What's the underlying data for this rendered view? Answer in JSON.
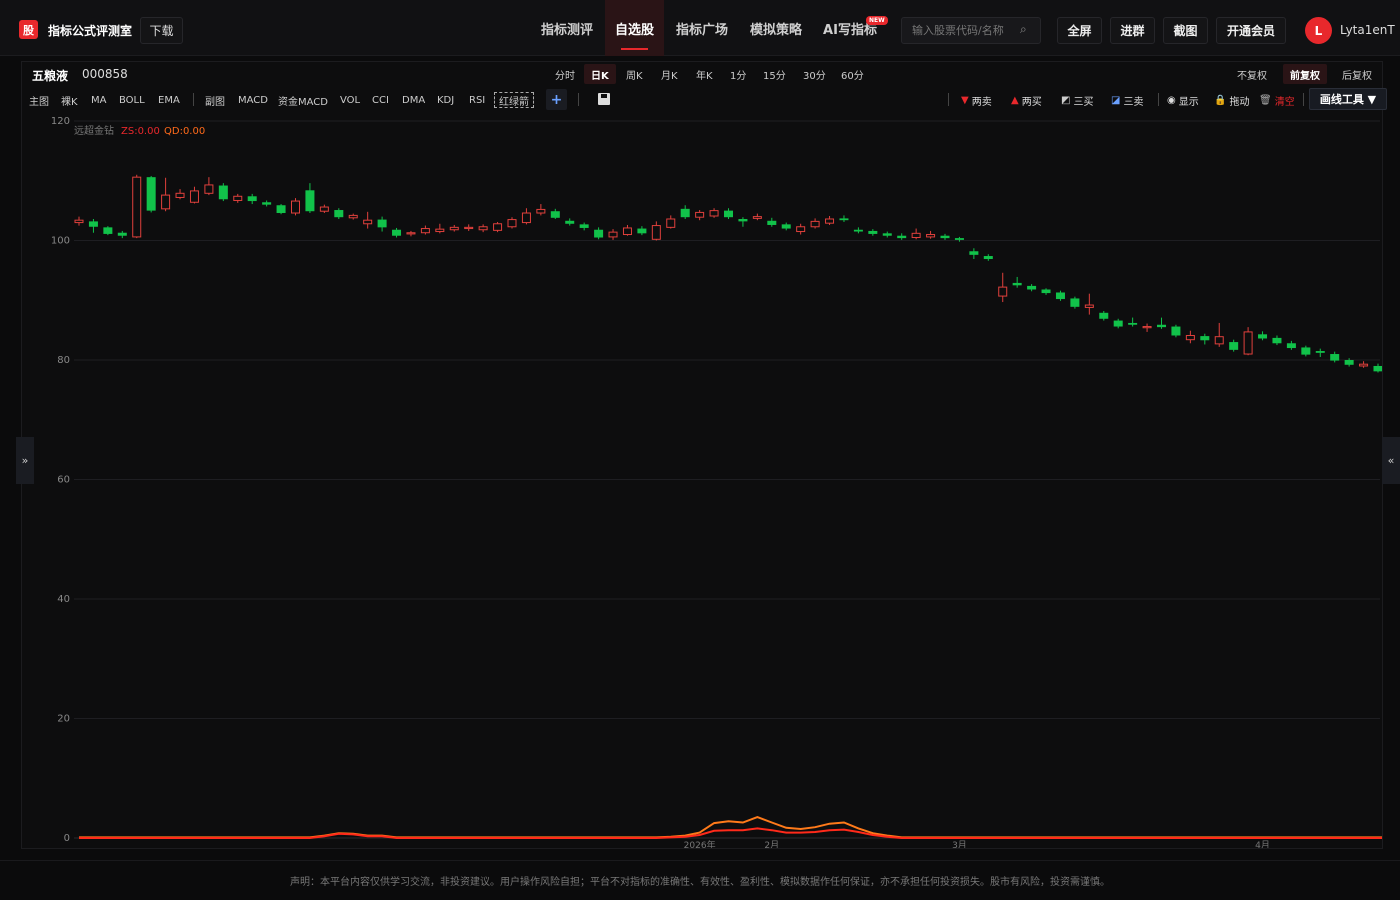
{
  "header": {
    "logo_char": "股",
    "app_name": "指标公式评测室",
    "download_label": "下载",
    "nav": [
      {
        "label": "指标测评",
        "active": false
      },
      {
        "label": "自选股",
        "active": true
      },
      {
        "label": "指标广场",
        "active": false
      },
      {
        "label": "模拟策略",
        "active": false
      },
      {
        "label": "AI写指标",
        "active": false,
        "badge": "NEW"
      }
    ],
    "search_placeholder": "输入股票代码/名称",
    "buttons": [
      "全屏",
      "进群",
      "截图",
      "开通会员"
    ],
    "avatar_letter": "L",
    "username": "Lyta1enT"
  },
  "stock": {
    "name": "五粮液",
    "code": "000858"
  },
  "periods": [
    {
      "label": "分时",
      "active": false
    },
    {
      "label": "日K",
      "active": true
    },
    {
      "label": "周K",
      "active": false
    },
    {
      "label": "月K",
      "active": false
    },
    {
      "label": "年K",
      "active": false
    },
    {
      "label": "1分",
      "active": false
    },
    {
      "label": "15分",
      "active": false
    },
    {
      "label": "30分",
      "active": false
    },
    {
      "label": "60分",
      "active": false
    }
  ],
  "adjust": [
    {
      "label": "不复权",
      "active": false
    },
    {
      "label": "前复权",
      "active": true
    },
    {
      "label": "后复权",
      "active": false
    }
  ],
  "indicators": {
    "main_group": [
      "主图",
      "裸K",
      "MA",
      "BOLL",
      "EMA"
    ],
    "sub_group": [
      "副图",
      "MACD",
      "资金MACD",
      "VOL",
      "CCI",
      "DMA",
      "KDJ",
      "RSI",
      "红绿箭"
    ],
    "add_label": "+"
  },
  "tools": {
    "two_sell": "两卖",
    "two_buy": "两买",
    "three_buy": "三买",
    "three_sell": "三卖",
    "show": "显示",
    "drag": "拖动",
    "clear": "清空",
    "draw_tools": "画线工具 ▼"
  },
  "legend": {
    "name": "远超金钻",
    "zs": "ZS:0.00",
    "qd": "QD:0.00"
  },
  "side_tabs": {
    "left": "»",
    "right": "«"
  },
  "footer": "声明：本平台内容仅供学习交流，非投资建议。用户操作风险自担；平台不对指标的准确性、有效性、盈利性、模拟数据作任何保证，亦不承担任何投资损失。股市有风险，投资需谨慎。",
  "colors": {
    "up": "#e0403c",
    "down": "#11c24a",
    "accent": "#e8282c",
    "line_orange": "#ff7a1a",
    "line_red": "#ff2a1a"
  },
  "chart_data": {
    "type": "candlestick",
    "ylim": [
      0,
      120
    ],
    "y_ticks": [
      0,
      20,
      40,
      60,
      80,
      100,
      120
    ],
    "x_labels": [
      "2026年",
      "2月",
      "3月",
      "4月"
    ],
    "x_label_positions": [
      43,
      48,
      61,
      82
    ],
    "candles": [
      {
        "o": 103.0,
        "c": 103.4,
        "h": 104.0,
        "l": 102.5
      },
      {
        "o": 103.2,
        "c": 102.3,
        "h": 103.6,
        "l": 101.3
      },
      {
        "o": 102.2,
        "c": 101.1,
        "h": 102.4,
        "l": 100.9
      },
      {
        "o": 101.3,
        "c": 100.8,
        "h": 101.6,
        "l": 100.4
      },
      {
        "o": 100.6,
        "c": 110.6,
        "h": 111.0,
        "l": 100.4
      },
      {
        "o": 110.6,
        "c": 105.0,
        "h": 110.8,
        "l": 104.7
      },
      {
        "o": 105.3,
        "c": 107.6,
        "h": 110.5,
        "l": 104.9
      },
      {
        "o": 107.2,
        "c": 107.9,
        "h": 108.6,
        "l": 106.9
      },
      {
        "o": 106.4,
        "c": 108.3,
        "h": 109.0,
        "l": 106.2
      },
      {
        "o": 107.9,
        "c": 109.3,
        "h": 110.6,
        "l": 107.6
      },
      {
        "o": 109.2,
        "c": 106.9,
        "h": 109.6,
        "l": 106.6
      },
      {
        "o": 106.7,
        "c": 107.4,
        "h": 107.8,
        "l": 106.3
      },
      {
        "o": 107.4,
        "c": 106.6,
        "h": 107.8,
        "l": 106.1
      },
      {
        "o": 106.4,
        "c": 106.0,
        "h": 106.7,
        "l": 105.7
      },
      {
        "o": 105.9,
        "c": 104.6,
        "h": 106.1,
        "l": 104.4
      },
      {
        "o": 104.6,
        "c": 106.6,
        "h": 107.1,
        "l": 104.2
      },
      {
        "o": 108.4,
        "c": 104.9,
        "h": 109.6,
        "l": 104.6
      },
      {
        "o": 104.9,
        "c": 105.6,
        "h": 106.0,
        "l": 104.6
      },
      {
        "o": 105.1,
        "c": 103.9,
        "h": 105.4,
        "l": 103.6
      },
      {
        "o": 103.8,
        "c": 104.2,
        "h": 104.5,
        "l": 103.5
      },
      {
        "o": 102.8,
        "c": 103.4,
        "h": 104.8,
        "l": 102.0
      },
      {
        "o": 103.5,
        "c": 102.2,
        "h": 104.0,
        "l": 101.5
      },
      {
        "o": 101.8,
        "c": 100.8,
        "h": 102.1,
        "l": 100.5
      },
      {
        "o": 101.1,
        "c": 101.3,
        "h": 101.6,
        "l": 100.7
      },
      {
        "o": 101.3,
        "c": 102.0,
        "h": 102.5,
        "l": 101.0
      },
      {
        "o": 101.5,
        "c": 101.9,
        "h": 102.8,
        "l": 101.2
      },
      {
        "o": 101.8,
        "c": 102.2,
        "h": 102.6,
        "l": 101.5
      },
      {
        "o": 102.0,
        "c": 102.2,
        "h": 102.7,
        "l": 101.6
      },
      {
        "o": 101.8,
        "c": 102.3,
        "h": 102.7,
        "l": 101.4
      },
      {
        "o": 101.7,
        "c": 102.8,
        "h": 103.1,
        "l": 101.4
      },
      {
        "o": 102.3,
        "c": 103.5,
        "h": 103.9,
        "l": 102.0
      },
      {
        "o": 103.0,
        "c": 104.6,
        "h": 105.4,
        "l": 102.7
      },
      {
        "o": 104.6,
        "c": 105.2,
        "h": 106.1,
        "l": 104.2
      },
      {
        "o": 104.9,
        "c": 103.8,
        "h": 105.3,
        "l": 103.6
      },
      {
        "o": 103.3,
        "c": 102.8,
        "h": 103.7,
        "l": 102.5
      },
      {
        "o": 102.7,
        "c": 102.1,
        "h": 103.0,
        "l": 101.7
      },
      {
        "o": 101.8,
        "c": 100.5,
        "h": 102.2,
        "l": 100.2
      },
      {
        "o": 100.6,
        "c": 101.4,
        "h": 101.9,
        "l": 100.1
      },
      {
        "o": 101.0,
        "c": 102.1,
        "h": 102.6,
        "l": 100.8
      },
      {
        "o": 102.0,
        "c": 101.2,
        "h": 102.4,
        "l": 100.9
      },
      {
        "o": 100.2,
        "c": 102.5,
        "h": 103.2,
        "l": 100.0
      },
      {
        "o": 102.2,
        "c": 103.6,
        "h": 104.2,
        "l": 102.0
      },
      {
        "o": 105.3,
        "c": 103.9,
        "h": 105.9,
        "l": 103.6
      },
      {
        "o": 103.9,
        "c": 104.7,
        "h": 105.1,
        "l": 103.4
      },
      {
        "o": 104.1,
        "c": 105.0,
        "h": 105.4,
        "l": 103.8
      },
      {
        "o": 105.0,
        "c": 103.9,
        "h": 105.4,
        "l": 103.6
      },
      {
        "o": 103.6,
        "c": 103.2,
        "h": 103.9,
        "l": 102.3
      },
      {
        "o": 103.7,
        "c": 104.0,
        "h": 104.5,
        "l": 103.4
      },
      {
        "o": 103.3,
        "c": 102.6,
        "h": 103.8,
        "l": 102.3
      },
      {
        "o": 102.7,
        "c": 102.0,
        "h": 103.0,
        "l": 101.7
      },
      {
        "o": 101.5,
        "c": 102.3,
        "h": 102.8,
        "l": 101.0
      },
      {
        "o": 102.3,
        "c": 103.2,
        "h": 103.7,
        "l": 102.0
      },
      {
        "o": 102.9,
        "c": 103.6,
        "h": 104.1,
        "l": 102.6
      },
      {
        "o": 103.7,
        "c": 103.4,
        "h": 104.2,
        "l": 103.1
      },
      {
        "o": 101.8,
        "c": 101.5,
        "h": 102.2,
        "l": 101.2
      },
      {
        "o": 101.6,
        "c": 101.1,
        "h": 101.9,
        "l": 100.8
      },
      {
        "o": 101.2,
        "c": 100.8,
        "h": 101.5,
        "l": 100.5
      },
      {
        "o": 100.8,
        "c": 100.4,
        "h": 101.2,
        "l": 100.1
      },
      {
        "o": 100.5,
        "c": 101.2,
        "h": 102.0,
        "l": 100.2
      },
      {
        "o": 100.6,
        "c": 101.0,
        "h": 101.6,
        "l": 100.3
      },
      {
        "o": 100.8,
        "c": 100.4,
        "h": 101.1,
        "l": 100.1
      },
      {
        "o": 100.4,
        "c": 100.1,
        "h": 100.6,
        "l": 99.8
      },
      {
        "o": 98.2,
        "c": 97.6,
        "h": 98.7,
        "l": 96.9
      },
      {
        "o": 97.4,
        "c": 96.9,
        "h": 97.7,
        "l": 96.6
      },
      {
        "o": 90.7,
        "c": 92.2,
        "h": 94.6,
        "l": 89.7
      },
      {
        "o": 92.9,
        "c": 92.5,
        "h": 93.9,
        "l": 92.1
      },
      {
        "o": 92.4,
        "c": 91.8,
        "h": 92.7,
        "l": 91.5
      },
      {
        "o": 91.8,
        "c": 91.2,
        "h": 92.0,
        "l": 90.9
      },
      {
        "o": 91.3,
        "c": 90.2,
        "h": 91.6,
        "l": 89.9
      },
      {
        "o": 90.3,
        "c": 88.9,
        "h": 90.6,
        "l": 88.6
      },
      {
        "o": 88.8,
        "c": 89.2,
        "h": 91.1,
        "l": 87.6
      },
      {
        "o": 87.9,
        "c": 86.9,
        "h": 88.2,
        "l": 86.6
      },
      {
        "o": 86.6,
        "c": 85.6,
        "h": 86.9,
        "l": 85.3
      },
      {
        "o": 86.2,
        "c": 85.9,
        "h": 87.1,
        "l": 85.6
      },
      {
        "o": 85.4,
        "c": 85.6,
        "h": 86.1,
        "l": 84.7
      },
      {
        "o": 85.9,
        "c": 85.5,
        "h": 87.1,
        "l": 85.2
      },
      {
        "o": 85.6,
        "c": 84.1,
        "h": 85.9,
        "l": 83.8
      },
      {
        "o": 83.4,
        "c": 84.1,
        "h": 84.9,
        "l": 82.8
      },
      {
        "o": 84.0,
        "c": 83.3,
        "h": 84.4,
        "l": 82.6
      },
      {
        "o": 82.7,
        "c": 83.9,
        "h": 86.2,
        "l": 82.2
      },
      {
        "o": 83.0,
        "c": 81.7,
        "h": 83.4,
        "l": 81.4
      },
      {
        "o": 81.0,
        "c": 84.7,
        "h": 85.5,
        "l": 80.8
      },
      {
        "o": 84.3,
        "c": 83.6,
        "h": 84.8,
        "l": 83.3
      },
      {
        "o": 83.7,
        "c": 82.8,
        "h": 84.1,
        "l": 82.5
      },
      {
        "o": 82.8,
        "c": 82.0,
        "h": 83.2,
        "l": 81.7
      },
      {
        "o": 82.1,
        "c": 80.9,
        "h": 82.4,
        "l": 80.6
      },
      {
        "o": 81.5,
        "c": 81.2,
        "h": 81.9,
        "l": 80.5
      },
      {
        "o": 81.0,
        "c": 79.9,
        "h": 81.4,
        "l": 79.6
      },
      {
        "o": 80.0,
        "c": 79.2,
        "h": 80.3,
        "l": 78.9
      },
      {
        "o": 79.0,
        "c": 79.3,
        "h": 79.8,
        "l": 78.7
      },
      {
        "o": 79.0,
        "c": 78.1,
        "h": 79.4,
        "l": 77.9
      }
    ],
    "series": [
      {
        "name": "ZS",
        "color": "#ff7a1a",
        "points": [
          [
            0,
            0.1
          ],
          [
            16,
            0.1
          ],
          [
            17,
            0.4
          ],
          [
            18,
            0.8
          ],
          [
            19,
            0.7
          ],
          [
            20,
            0.4
          ],
          [
            21,
            0.4
          ],
          [
            22,
            0.1
          ],
          [
            40,
            0.1
          ],
          [
            41,
            0.2
          ],
          [
            42,
            0.4
          ],
          [
            43,
            0.9
          ],
          [
            44,
            2.5
          ],
          [
            45,
            2.8
          ],
          [
            46,
            2.6
          ],
          [
            47,
            3.5
          ],
          [
            48,
            2.6
          ],
          [
            49,
            1.7
          ],
          [
            50,
            1.5
          ],
          [
            51,
            1.8
          ],
          [
            52,
            2.4
          ],
          [
            53,
            2.6
          ],
          [
            54,
            1.6
          ],
          [
            55,
            0.8
          ],
          [
            56,
            0.4
          ],
          [
            57,
            0.1
          ],
          [
            91,
            0.1
          ]
        ]
      },
      {
        "name": "QD",
        "color": "#ff2a1a",
        "points": [
          [
            0,
            0.0
          ],
          [
            16,
            0.0
          ],
          [
            17,
            0.3
          ],
          [
            18,
            0.7
          ],
          [
            19,
            0.6
          ],
          [
            20,
            0.3
          ],
          [
            21,
            0.3
          ],
          [
            22,
            0.0
          ],
          [
            40,
            0.0
          ],
          [
            41,
            0.1
          ],
          [
            42,
            0.2
          ],
          [
            43,
            0.5
          ],
          [
            44,
            1.2
          ],
          [
            45,
            1.3
          ],
          [
            46,
            1.3
          ],
          [
            47,
            1.6
          ],
          [
            48,
            1.3
          ],
          [
            49,
            0.9
          ],
          [
            50,
            0.9
          ],
          [
            51,
            1.0
          ],
          [
            52,
            1.3
          ],
          [
            53,
            1.4
          ],
          [
            54,
            1.0
          ],
          [
            55,
            0.5
          ],
          [
            56,
            0.2
          ],
          [
            57,
            0.0
          ],
          [
            91,
            0.0
          ]
        ]
      }
    ]
  }
}
